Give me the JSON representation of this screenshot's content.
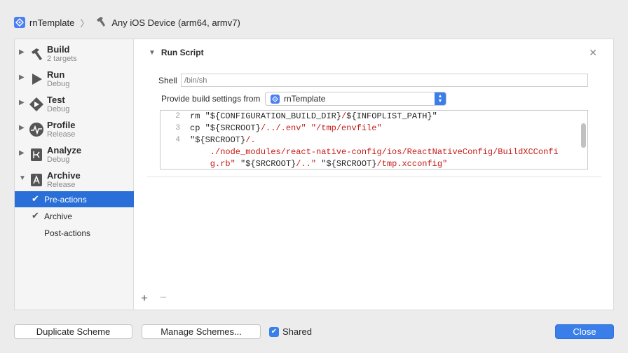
{
  "toolbar": {
    "scheme_name": "rnTemplate",
    "separator": "〉",
    "destination": "Any iOS Device (arm64, armv7)"
  },
  "sidebar": {
    "items": [
      {
        "title": "Build",
        "subtitle": "2 targets",
        "icon": "hammer-icon"
      },
      {
        "title": "Run",
        "subtitle": "Debug",
        "icon": "play-icon"
      },
      {
        "title": "Test",
        "subtitle": "Debug",
        "icon": "test-diamond-icon"
      },
      {
        "title": "Profile",
        "subtitle": "Release",
        "icon": "waveform-icon"
      },
      {
        "title": "Analyze",
        "subtitle": "Debug",
        "icon": "analyze-icon"
      },
      {
        "title": "Archive",
        "subtitle": "Release",
        "icon": "archive-icon"
      }
    ],
    "sub_items": [
      {
        "label": "Pre-actions",
        "checked": true,
        "selected": true
      },
      {
        "label": "Archive",
        "checked": true,
        "selected": false
      },
      {
        "label": "Post-actions",
        "checked": false,
        "selected": false
      }
    ]
  },
  "run_script": {
    "title": "Run Script",
    "shell_label": "Shell",
    "shell_placeholder": "/bin/sh",
    "provide_label": "Provide build settings from",
    "provide_value": "rnTemplate"
  },
  "code": {
    "line_numbers": [
      "2",
      "3",
      "4",
      "",
      ""
    ],
    "lines": [
      [
        {
          "t": "rm ",
          "c": "k"
        },
        {
          "t": "\"${CONFIGURATION_BUILD_DIR}",
          "c": "k"
        },
        {
          "t": "/",
          "c": "s"
        },
        {
          "t": "${INFOPLIST_PATH}\"",
          "c": "k"
        }
      ],
      [
        {
          "t": "cp ",
          "c": "k"
        },
        {
          "t": "\"${SRCROOT}",
          "c": "k"
        },
        {
          "t": "/../.env\"",
          "c": "s"
        },
        {
          "t": " ",
          "c": "k"
        },
        {
          "t": "\"/tmp/envfile\"",
          "c": "s"
        }
      ],
      [
        {
          "t": "\"${SRCROOT}",
          "c": "k"
        },
        {
          "t": "/.",
          "c": "s"
        }
      ],
      [
        {
          "t": "    ./node_modules/react-native-config/ios/ReactNativeConfig/BuildXCConfi",
          "c": "s"
        }
      ],
      [
        {
          "t": "    g.rb\"",
          "c": "s"
        },
        {
          "t": " \"${SRCROOT}",
          "c": "k"
        },
        {
          "t": "/..\"",
          "c": "s"
        },
        {
          "t": " \"${SRCROOT}",
          "c": "k"
        },
        {
          "t": "/tmp.xcconfig\"",
          "c": "s"
        }
      ]
    ]
  },
  "footer": {
    "duplicate_label": "Duplicate Scheme",
    "manage_label": "Manage Schemes...",
    "shared_label": "Shared",
    "shared_checked": true,
    "close_label": "Close"
  },
  "colors": {
    "accent": "#3a7ee9",
    "selection": "#2a6fd8",
    "string": "#c41a16"
  }
}
